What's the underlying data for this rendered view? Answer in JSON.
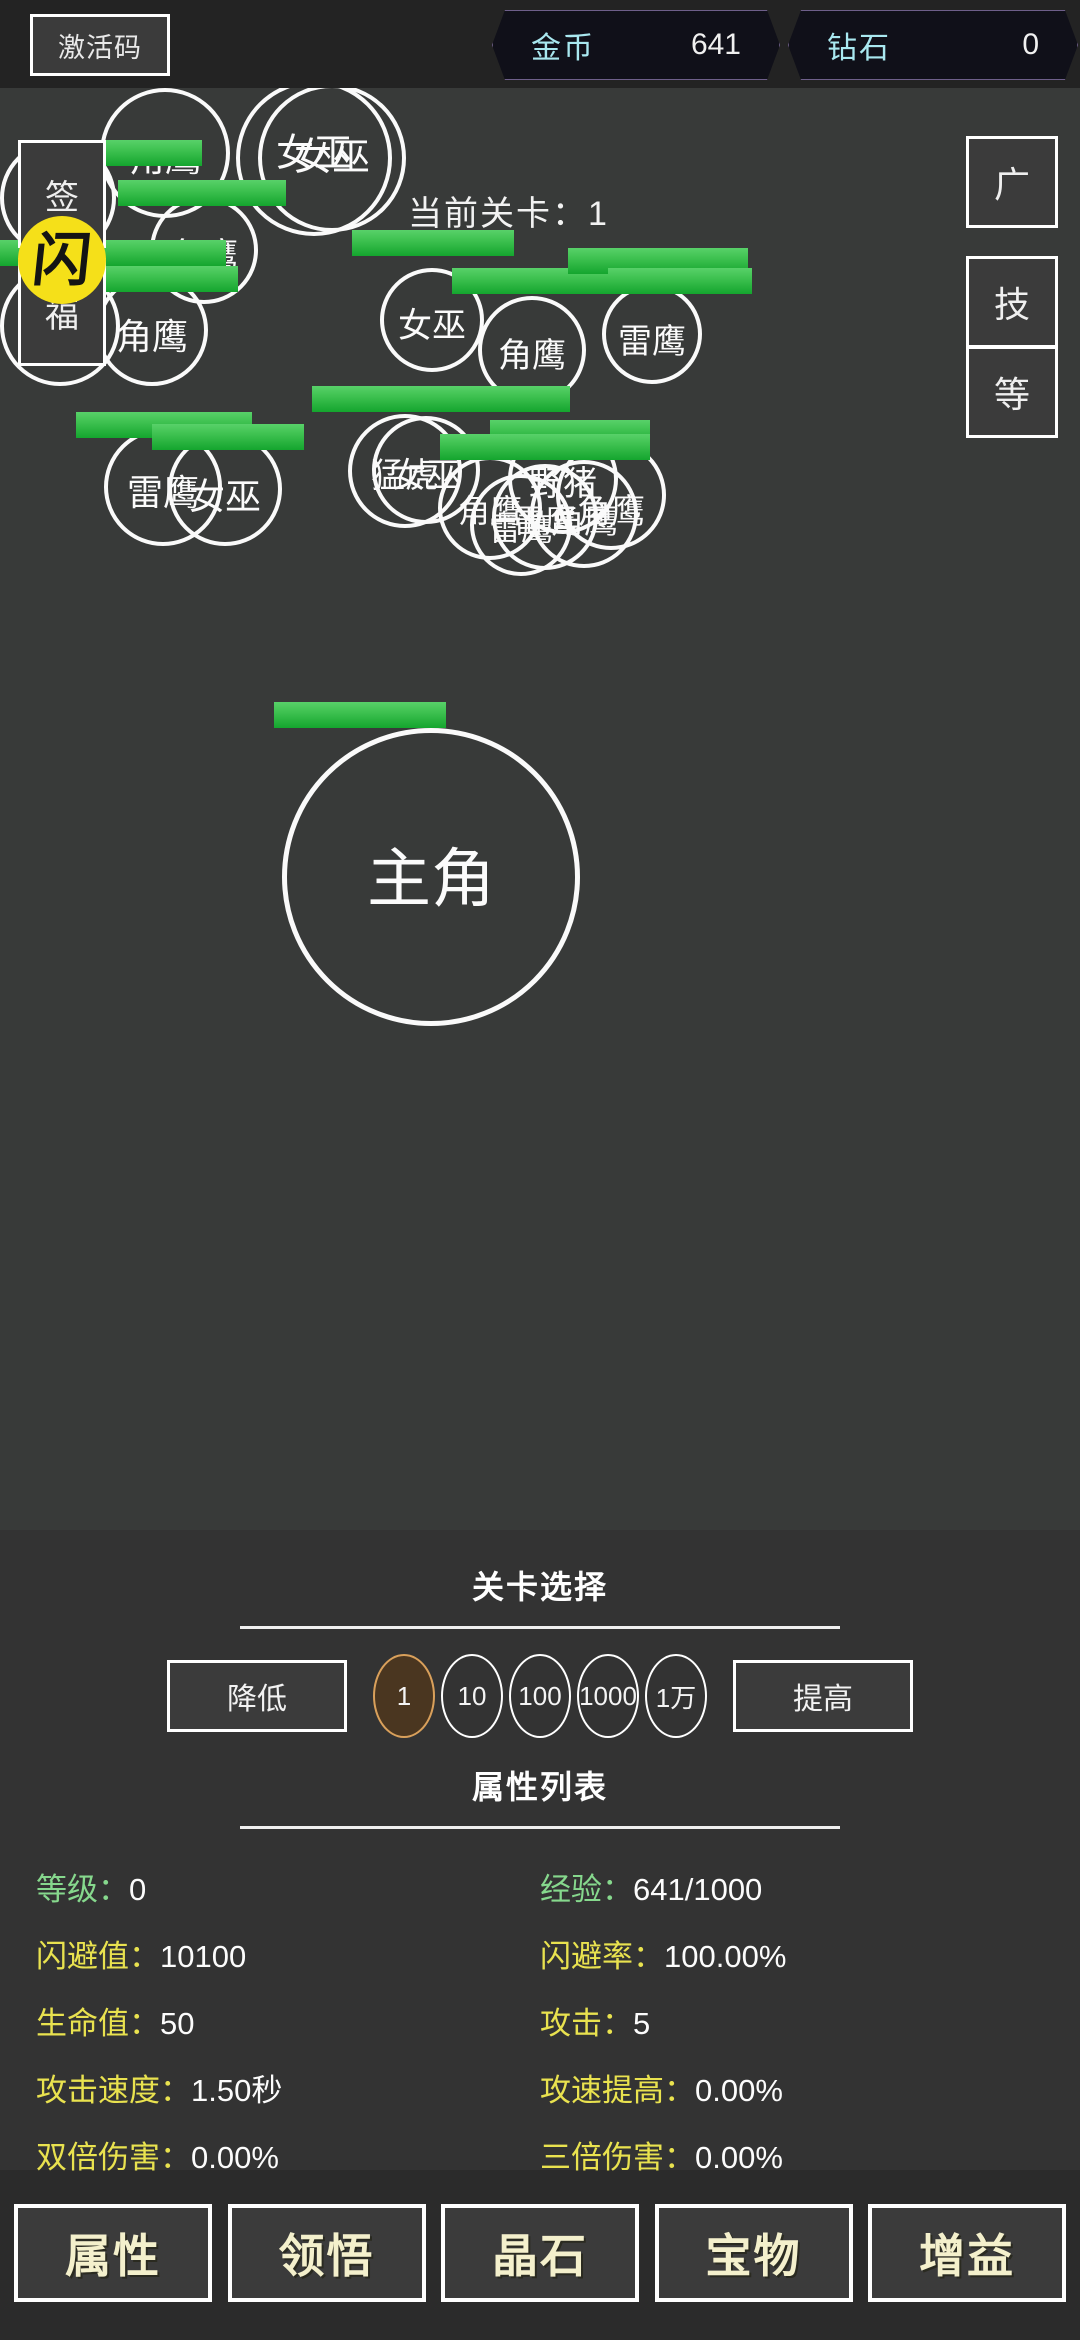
{
  "topbar": {
    "code_button": "激活码",
    "currencies": [
      {
        "label": "金币",
        "value": "641"
      },
      {
        "label": "钻石",
        "value": "0"
      }
    ]
  },
  "battlefield": {
    "stage_label": "当前关卡：1",
    "logo_text": "闪",
    "left_buttons": [
      {
        "label": "签"
      },
      {
        "label": "福"
      }
    ],
    "right_buttons": [
      {
        "label": "广"
      },
      {
        "label": "技"
      },
      {
        "label": "等"
      }
    ],
    "hero": {
      "name": "主角"
    },
    "enemies": [
      {
        "name": "角鹰"
      },
      {
        "name": "野猪"
      },
      {
        "name": "女巫"
      },
      {
        "name": "女巫"
      },
      {
        "name": "野猪"
      },
      {
        "name": "角鹰"
      },
      {
        "name": "角鹰"
      },
      {
        "name": "女巫"
      },
      {
        "name": "角鹰"
      },
      {
        "name": "雷鹰"
      },
      {
        "name": "雷鹰"
      },
      {
        "name": "女巫"
      },
      {
        "name": "猛虎"
      },
      {
        "name": "女巫"
      },
      {
        "name": "角鹰"
      },
      {
        "name": "雷鹰"
      },
      {
        "name": "野猪"
      },
      {
        "name": "雷鹰"
      },
      {
        "name": "角鹰"
      },
      {
        "name": "角鹰"
      }
    ]
  },
  "level_select": {
    "title": "关卡选择",
    "decrease_label": "降低",
    "increase_label": "提高",
    "steps": [
      "1",
      "10",
      "100",
      "1000",
      "1万"
    ],
    "active_step": "1"
  },
  "attributes": {
    "title": "属性列表",
    "items": [
      {
        "key": "等级：",
        "value": "0",
        "accent": "green"
      },
      {
        "key": "经验：",
        "value": "641/1000",
        "accent": "green"
      },
      {
        "key": "闪避值：",
        "value": "10100",
        "accent": "yellow"
      },
      {
        "key": "闪避率：",
        "value": "100.00%",
        "accent": "yellow"
      },
      {
        "key": "生命值：",
        "value": "50",
        "accent": "yellow"
      },
      {
        "key": "攻击：",
        "value": "5",
        "accent": "yellow"
      },
      {
        "key": "攻击速度：",
        "value": "1.50秒",
        "accent": "yellow"
      },
      {
        "key": "攻速提高：",
        "value": "0.00%",
        "accent": "yellow"
      },
      {
        "key": "双倍伤害：",
        "value": "0.00%",
        "accent": "yellow"
      },
      {
        "key": "三倍伤害：",
        "value": "0.00%",
        "accent": "yellow"
      }
    ]
  },
  "bottom_nav": {
    "items": [
      "属性",
      "领悟",
      "晶石",
      "宝物",
      "增益"
    ]
  },
  "colors": {
    "hp_bar": "#2bb43c",
    "accent_yellow": "#e9e24f",
    "accent_green": "#86d88d",
    "logo_bg": "#f5e019",
    "chip_active_bg": "#4a3620",
    "chip_active_border": "#d9a05b",
    "currency_label": "#a9e8f0"
  }
}
